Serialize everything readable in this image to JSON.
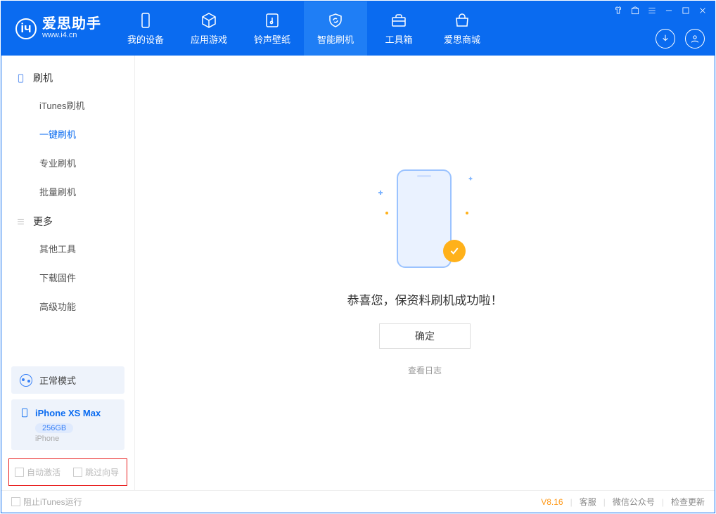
{
  "app": {
    "title": "爱思助手",
    "url": "www.i4.cn"
  },
  "nav": {
    "items": [
      {
        "label": "我的设备"
      },
      {
        "label": "应用游戏"
      },
      {
        "label": "铃声壁纸"
      },
      {
        "label": "智能刷机"
      },
      {
        "label": "工具箱"
      },
      {
        "label": "爱思商城"
      }
    ],
    "active_index": 3
  },
  "sidebar": {
    "groups": [
      {
        "title": "刷机",
        "items": [
          "iTunes刷机",
          "一键刷机",
          "专业刷机",
          "批量刷机"
        ],
        "active_index": 1
      },
      {
        "title": "更多",
        "items": [
          "其他工具",
          "下载固件",
          "高级功能"
        ]
      }
    ],
    "mode": {
      "label": "正常模式"
    },
    "device": {
      "name": "iPhone XS Max",
      "capacity": "256GB",
      "type": "iPhone"
    },
    "options": {
      "auto_activate": "自动激活",
      "skip_guide": "跳过向导"
    }
  },
  "main": {
    "success_text": "恭喜您，保资料刷机成功啦！",
    "ok_button": "确定",
    "view_log": "查看日志"
  },
  "footer": {
    "block_itunes": "阻止iTunes运行",
    "version": "V8.16",
    "links": [
      "客服",
      "微信公众号",
      "检查更新"
    ]
  }
}
